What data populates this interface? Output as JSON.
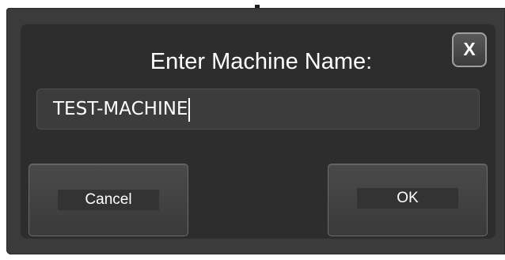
{
  "dialog": {
    "title": "Enter Machine Name:",
    "close_label": "X",
    "machine_name_value": "TEST-MACHINE",
    "cancel_label": "Cancel",
    "ok_label": "OK"
  }
}
